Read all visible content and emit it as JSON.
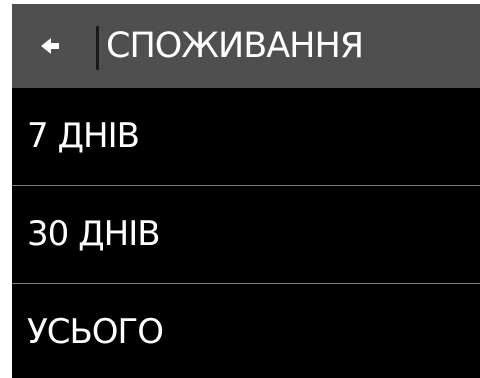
{
  "header": {
    "back_icon": "back-arrow-icon",
    "title": "СПОЖИВАННЯ"
  },
  "menu": {
    "items": [
      {
        "label": "7 ДНІВ"
      },
      {
        "label": "30 ДНІВ"
      },
      {
        "label": "УСЬОГО"
      }
    ]
  },
  "colors": {
    "header_bg": "#4f4f4f",
    "screen_bg": "#000000",
    "text": "#ffffff",
    "separator": "#7a7a7a"
  }
}
